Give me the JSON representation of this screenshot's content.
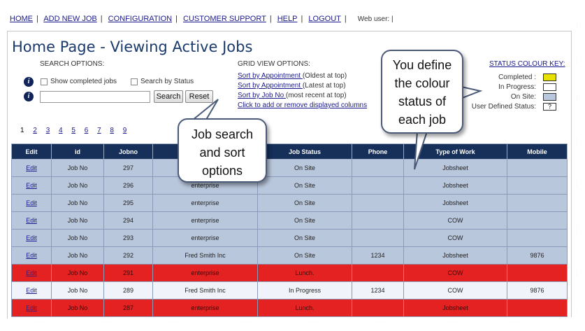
{
  "nav": {
    "links": [
      "HOME",
      "ADD NEW JOB",
      "CONFIGURATION",
      "CUSTOMER SUPPORT",
      "HELP",
      "LOGOUT"
    ],
    "separator": "|",
    "web_user_label": "Web user: |"
  },
  "page_title": "Home Page - Viewing Active Jobs",
  "search": {
    "label": "SEARCH OPTIONS:",
    "show_completed_label": "Show completed jobs",
    "search_by_status_label": "Search by Status",
    "input_value": "",
    "search_button": "Search",
    "reset_button": "Reset"
  },
  "grid_view": {
    "label": "GRID VIEW OPTIONS:",
    "options": [
      {
        "link": "Sort by Appointment ",
        "suffix": "(Oldest at top)"
      },
      {
        "link": "Sort by Appointment ",
        "suffix": "(Latest at top)"
      },
      {
        "link": "Sort by Job No ",
        "suffix": "(most recent at top)"
      },
      {
        "link": "Click to add or remove displayed  columns",
        "suffix": ""
      }
    ]
  },
  "status_key": {
    "title": "STATUS COLOUR KEY:",
    "items": [
      {
        "label": "Completed :",
        "color": "#e8e000",
        "mark": ""
      },
      {
        "label": "In Progress:",
        "color": "#ffffff",
        "mark": ""
      },
      {
        "label": "On Site:",
        "color": "#b9c7dc",
        "mark": ""
      },
      {
        "label": "User Defined Status:",
        "color": "#ffffff",
        "mark": "?"
      }
    ]
  },
  "pager": {
    "current": "1",
    "pages": [
      "2",
      "3",
      "4",
      "5",
      "6",
      "7",
      "8",
      "9"
    ]
  },
  "table": {
    "columns": [
      "Edit",
      "id",
      "Jobno",
      "",
      "Job Status",
      "Phone",
      "Type of Work",
      "Mobile"
    ],
    "rows": [
      {
        "style": "onsite",
        "cells": [
          "Edit",
          "Job No",
          "297",
          "",
          "On Site",
          "",
          "Jobsheet",
          ""
        ]
      },
      {
        "style": "onsite",
        "cells": [
          "Edit",
          "Job No",
          "296",
          "enterprise",
          "On Site",
          "",
          "Jobsheet",
          ""
        ]
      },
      {
        "style": "onsite",
        "cells": [
          "Edit",
          "Job No",
          "295",
          "enterprise",
          "On Site",
          "",
          "Jobsheet",
          ""
        ]
      },
      {
        "style": "onsite",
        "cells": [
          "Edit",
          "Job No",
          "294",
          "enterprise",
          "On Site",
          "",
          "COW",
          ""
        ]
      },
      {
        "style": "onsite",
        "cells": [
          "Edit",
          "Job No",
          "293",
          "enterprise",
          "On Site",
          "",
          "COW",
          ""
        ]
      },
      {
        "style": "onsite",
        "cells": [
          "Edit",
          "Job No",
          "292",
          "Fred Smith Inc",
          "On Site",
          "1234",
          "Jobsheet",
          "9876"
        ]
      },
      {
        "style": "lunch",
        "cells": [
          "Edit",
          "Job No",
          "291",
          "enterprise",
          "Lunch.",
          "",
          "COW",
          ""
        ]
      },
      {
        "style": "progress",
        "cells": [
          "Edit",
          "Job No",
          "289",
          "Fred Smith Inc",
          "In Progress",
          "1234",
          "COW",
          "9876"
        ]
      },
      {
        "style": "lunch",
        "cells": [
          "Edit",
          "Job No",
          "287",
          "enterprise",
          "Lunch.",
          "",
          "Jobsheet",
          ""
        ]
      }
    ]
  },
  "callouts": {
    "job_search": [
      "Job search",
      "and sort",
      "options"
    ],
    "colour_status": [
      "You define",
      "the colour",
      "status of",
      "each job"
    ]
  }
}
